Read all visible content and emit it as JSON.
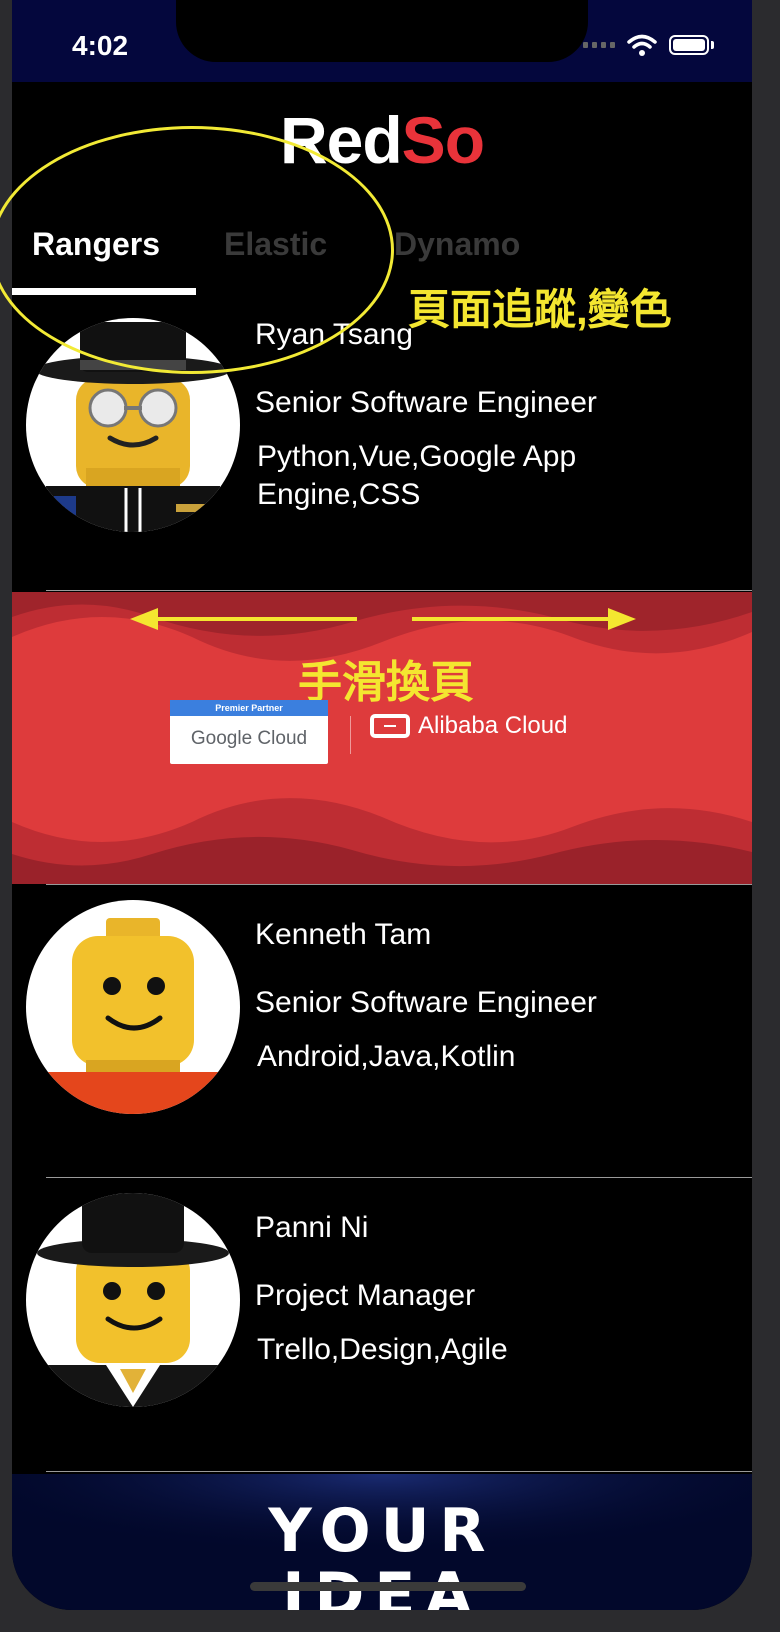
{
  "status_bar": {
    "time": "4:02"
  },
  "app": {
    "logo_part1": "Red",
    "logo_part2": "So"
  },
  "tabs": [
    {
      "label": "Rangers",
      "selected": true
    },
    {
      "label": "Elastic",
      "selected": false
    },
    {
      "label": "Dynamo",
      "selected": false
    }
  ],
  "annotations": {
    "tab_note": "頁面追蹤,變色",
    "swipe_note": "手滑換頁"
  },
  "members": [
    {
      "name": "Ryan Tsang",
      "role": "Senior Software Engineer",
      "skills": "Python,Vue,Google App Engine,CSS"
    },
    {
      "name": "Kenneth Tam",
      "role": "Senior Software Engineer",
      "skills": "Android,Java,Kotlin"
    },
    {
      "name": "Panni Ni",
      "role": "Project Manager",
      "skills": "Trello,Design,Agile"
    }
  ],
  "banner": {
    "partner_badge": "Premier Partner",
    "google_cloud": "Google Cloud",
    "alibaba_cloud": "Alibaba Cloud"
  },
  "bottom_banner": {
    "line1": "YOUR",
    "line2": "IDEA"
  },
  "colors": {
    "brand_red": "#e9333a",
    "status_bar_bg": "#04073d",
    "annotation_yellow": "#f4e630"
  }
}
